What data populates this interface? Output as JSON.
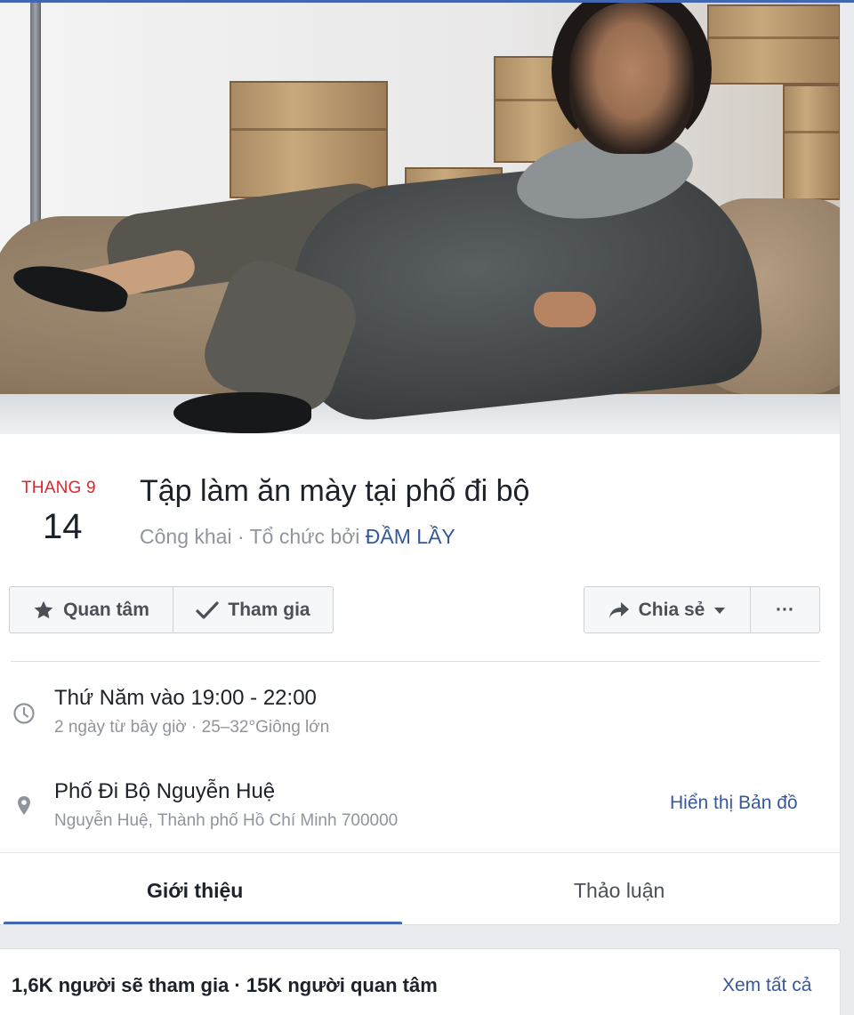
{
  "event": {
    "month": "THANG 9",
    "day": "14",
    "title": "Tập làm ăn mày tại phố đi bộ",
    "privacy_prefix": "Công khai · Tổ chức bởi ",
    "host": "ĐẦM LẦY"
  },
  "actions": {
    "interested": "Quan tâm",
    "going": "Tham gia",
    "share": "Chia sẻ",
    "more": "···"
  },
  "time": {
    "main": "Thứ Năm vào 19:00 - 22:00",
    "sub": "2 ngày từ bây giờ · 25–32°Giông lớn"
  },
  "location": {
    "name": "Phố Đi Bộ Nguyễn Huệ",
    "address": "Nguyễn Huệ, Thành phố Hồ Chí Minh 700000",
    "map_link": "Hiển thị Bản đồ"
  },
  "tabs": [
    {
      "label": "Giới thiệu",
      "active": true
    },
    {
      "label": "Thảo luận",
      "active": false
    }
  ],
  "stats": {
    "summary": "1,6K người sẽ tham gia · 15K người quan tâm",
    "see_all": "Xem tất cả"
  },
  "icons": {
    "interested": "star-icon",
    "going": "check-icon",
    "share": "share-arrow-icon",
    "dropdown": "caret-down-icon",
    "time": "clock-icon",
    "location": "map-pin-icon"
  },
  "colors": {
    "accent": "#4267b2",
    "link": "#365899",
    "date_month": "#e0242b",
    "muted": "#90949c"
  }
}
